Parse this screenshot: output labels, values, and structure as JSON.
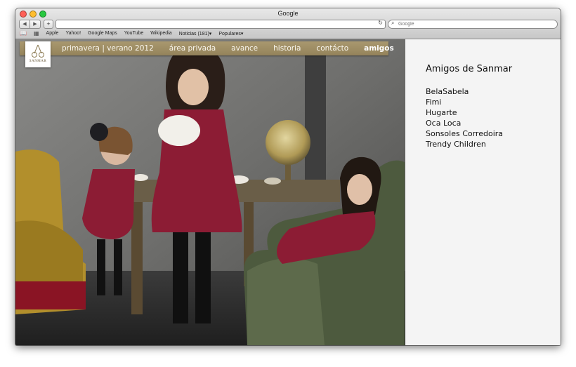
{
  "window": {
    "title": "Google"
  },
  "toolbar": {
    "back": "◀",
    "forward": "▶",
    "add": "+",
    "url": "",
    "search_placeholder": "Google"
  },
  "bookmarks": [
    {
      "label": "Apple"
    },
    {
      "label": "Yahoo!"
    },
    {
      "label": "Google Maps"
    },
    {
      "label": "YouTube"
    },
    {
      "label": "Wikipedia"
    },
    {
      "label": "Noticias (181)▾"
    },
    {
      "label": "Populares▾"
    }
  ],
  "site": {
    "logo_text": "SANMAR",
    "menu": [
      {
        "label": "primavera | verano 2012"
      },
      {
        "label": "área privada"
      },
      {
        "label": "avance"
      },
      {
        "label": "historia"
      },
      {
        "label": "contácto"
      },
      {
        "label": "amigos"
      }
    ],
    "active_menu": "amigos"
  },
  "sidebar": {
    "title": "Amigos de Sanmar",
    "links": [
      {
        "label": "BelaSabela"
      },
      {
        "label": "Fimi"
      },
      {
        "label": "Hugarte"
      },
      {
        "label": "Oca Loca"
      },
      {
        "label": "Sonsoles Corredoira"
      },
      {
        "label": "Trendy Children"
      }
    ]
  },
  "colors": {
    "nav_bar": "#a08f65",
    "sidebar_bg": "#f4f4f4",
    "dress_red": "#8c1c34"
  }
}
